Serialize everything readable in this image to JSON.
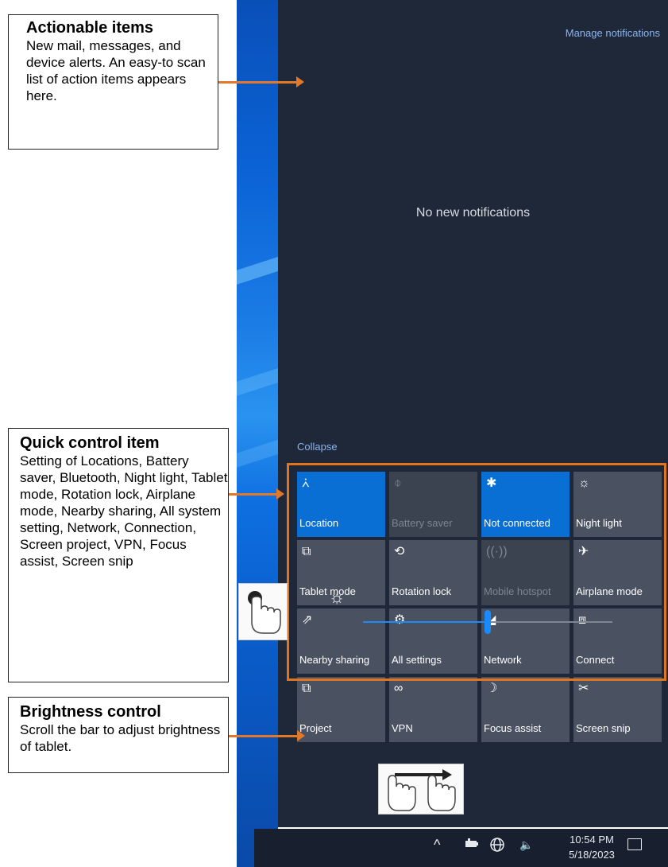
{
  "panel": {
    "manage_notifications": "Manage notifications",
    "empty_text": "No new notifications",
    "collapse_label": "Collapse"
  },
  "quick_actions": [
    {
      "label": "Location",
      "icon": "location-icon",
      "glyph": "⩑",
      "state": "on"
    },
    {
      "label": "Battery saver",
      "icon": "battery-saver-icon",
      "glyph": "⌽",
      "state": "disabled"
    },
    {
      "label": "Not connected",
      "icon": "bluetooth-icon",
      "glyph": "✱",
      "state": "on"
    },
    {
      "label": "Night light",
      "icon": "night-light-icon",
      "glyph": "☼",
      "state": "off"
    },
    {
      "label": "Tablet mode",
      "icon": "tablet-mode-icon",
      "glyph": "⧉",
      "state": "off"
    },
    {
      "label": "Rotation lock",
      "icon": "rotation-lock-icon",
      "glyph": "⟲",
      "state": "off"
    },
    {
      "label": "Mobile hotspot",
      "icon": "mobile-hotspot-icon",
      "glyph": "((·))",
      "state": "disabled"
    },
    {
      "label": "Airplane mode",
      "icon": "airplane-icon",
      "glyph": "✈",
      "state": "off"
    },
    {
      "label": "Nearby sharing",
      "icon": "nearby-sharing-icon",
      "glyph": "⇗",
      "state": "off"
    },
    {
      "label": "All settings",
      "icon": "settings-gear-icon",
      "glyph": "⚙",
      "state": "off"
    },
    {
      "label": "Network",
      "icon": "network-icon",
      "glyph": "◢",
      "state": "off"
    },
    {
      "label": "Connect",
      "icon": "connect-icon",
      "glyph": "⧈",
      "state": "off"
    },
    {
      "label": "Project",
      "icon": "project-icon",
      "glyph": "⧉",
      "state": "off"
    },
    {
      "label": "VPN",
      "icon": "vpn-icon",
      "glyph": "∞",
      "state": "off"
    },
    {
      "label": "Focus assist",
      "icon": "focus-assist-moon-icon",
      "glyph": "☽",
      "state": "off"
    },
    {
      "label": "Screen snip",
      "icon": "screen-snip-icon",
      "glyph": "✂",
      "state": "off"
    }
  ],
  "brightness": {
    "level_fraction": 0.5
  },
  "taskbar": {
    "time": "10:54 PM",
    "date": "5/18/2023",
    "chevron": "^",
    "volume": "🔈"
  },
  "callouts": {
    "actionable": {
      "title": "Actionable items",
      "text": "New mail, messages, and device alerts. An easy-to scan list of action items appears here."
    },
    "quick": {
      "title": "Quick control item",
      "text": "Setting of Locations, Battery saver, Bluetooth, Night light, Tablet mode, Rotation lock, Airplane mode, Nearby sharing, All system setting, Network, Connection, Screen project, VPN, Focus assist, Screen snip"
    },
    "brightness": {
      "title": "Brightness control",
      "text": "Scroll the bar to adjust brightness of tablet."
    }
  },
  "colors": {
    "accent": "#0a6fd4",
    "panel_bg": "#1f2838",
    "tile_off": "#4a5261",
    "callout_arrow": "#e2782a"
  }
}
